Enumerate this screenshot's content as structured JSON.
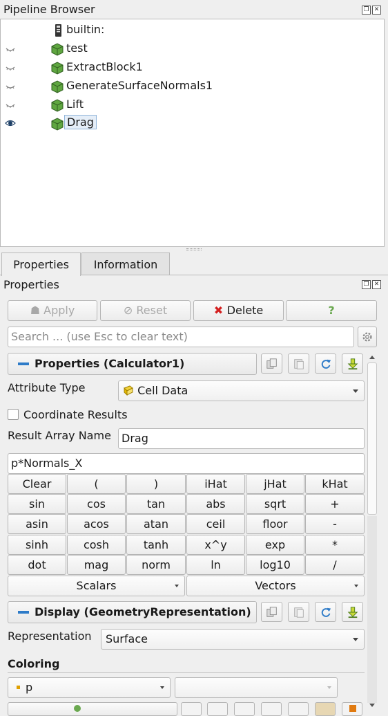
{
  "pipeline_browser": {
    "title": "Pipeline Browser",
    "items": [
      {
        "label": "builtin:",
        "visible": null,
        "icon": "server-icon"
      },
      {
        "label": "test",
        "visible": false,
        "icon": "dataset-cube-icon"
      },
      {
        "label": "ExtractBlock1",
        "visible": false,
        "icon": "dataset-cube-icon"
      },
      {
        "label": "GenerateSurfaceNormals1",
        "visible": false,
        "icon": "dataset-cube-icon"
      },
      {
        "label": "Lift",
        "visible": false,
        "icon": "dataset-cube-icon"
      },
      {
        "label": "Drag",
        "visible": true,
        "icon": "dataset-cube-icon",
        "selected": true
      }
    ]
  },
  "tabs": [
    {
      "label": "Properties",
      "active": true
    },
    {
      "label": "Information",
      "active": false
    }
  ],
  "properties_panel": {
    "title": "Properties",
    "apply_label": "Apply",
    "reset_label": "Reset",
    "delete_label": "Delete",
    "help_label": "?",
    "search_placeholder": "Search ... (use Esc to clear text)"
  },
  "properties_section": {
    "title": "Properties (Calculator1)",
    "attribute_type_label": "Attribute Type",
    "attribute_type_value": "Cell Data",
    "coordinate_results_label": "Coordinate Results",
    "coordinate_results_checked": false,
    "result_array_name_label": "Result Array Name",
    "result_array_name_value": "Drag",
    "expression_value": "p*Normals_X",
    "calc_buttons": [
      [
        "Clear",
        "(",
        ")",
        "iHat",
        "jHat",
        "kHat"
      ],
      [
        "sin",
        "cos",
        "tan",
        "abs",
        "sqrt",
        "+"
      ],
      [
        "asin",
        "acos",
        "atan",
        "ceil",
        "floor",
        "-"
      ],
      [
        "sinh",
        "cosh",
        "tanh",
        "x^y",
        "exp",
        "*"
      ],
      [
        "dot",
        "mag",
        "norm",
        "ln",
        "log10",
        "/"
      ]
    ],
    "scalars_label": "Scalars",
    "vectors_label": "Vectors"
  },
  "display_section": {
    "title": "Display (GeometryRepresentation)",
    "representation_label": "Representation",
    "representation_value": "Surface",
    "coloring_label": "Coloring",
    "coloring_value": "p"
  },
  "colors": {
    "accent_blue": "#2e7bc8",
    "delete_red": "#d42020",
    "cube_green": "#5fa640",
    "help_green": "#6aa84f"
  }
}
